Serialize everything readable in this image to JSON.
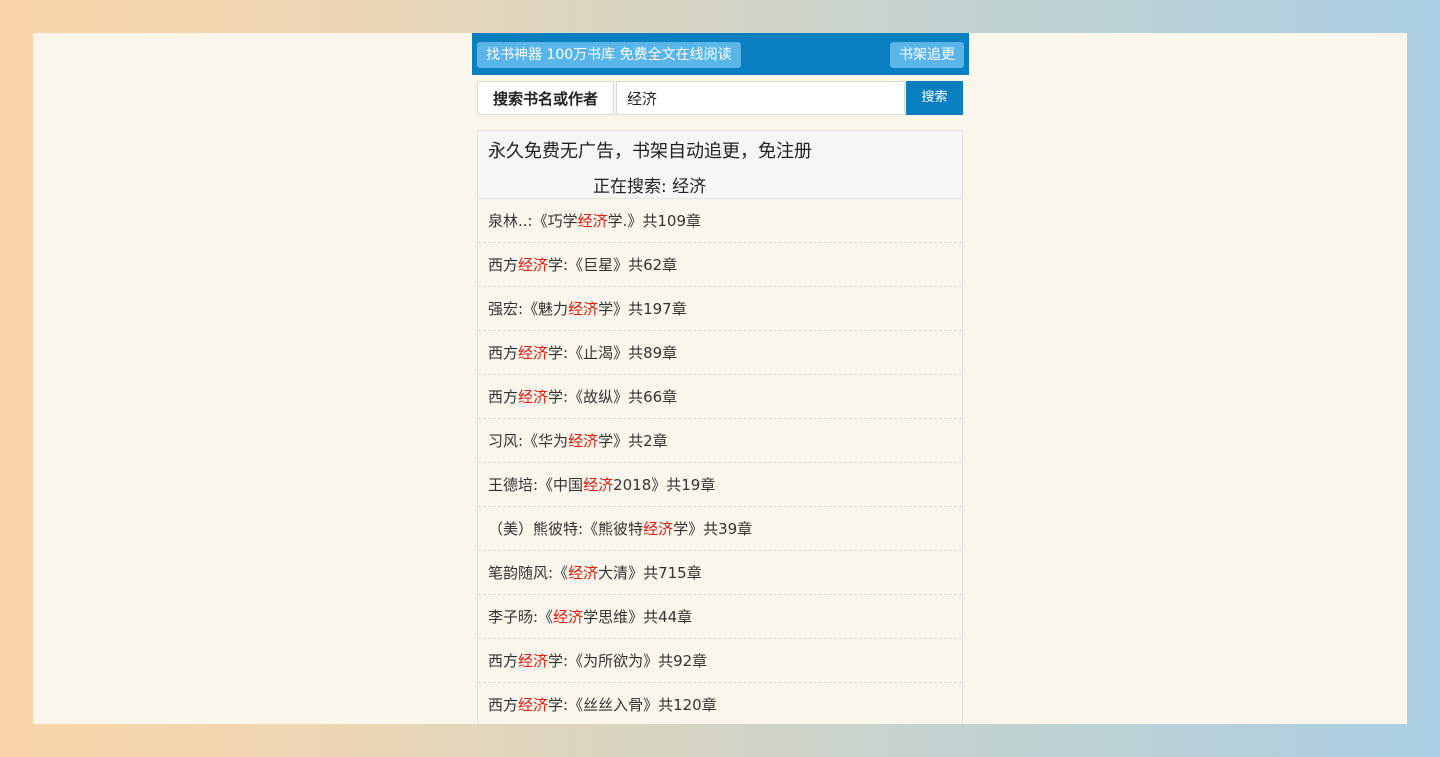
{
  "header": {
    "left_button": "找书神器 100万书库 免费全文在线阅读",
    "right_button": "书架追更"
  },
  "search": {
    "label": "搜索书名或作者",
    "value": "经济",
    "button": "搜索"
  },
  "panel": {
    "notice": "永久免费无广告，书架自动追更，免注册",
    "searching_prefix": "正在搜索: ",
    "searching_term": "经济"
  },
  "highlight_color": "#e8180c",
  "results": [
    {
      "pre": "泉林..:《巧学",
      "hl": "经济",
      "post": "学.》共109章"
    },
    {
      "pre": "西方",
      "hl": "经济",
      "post": "学:《巨星》共62章"
    },
    {
      "pre": "强宏:《魅力",
      "hl": "经济",
      "post": "学》共197章"
    },
    {
      "pre": "西方",
      "hl": "经济",
      "post": "学:《止渴》共89章"
    },
    {
      "pre": "西方",
      "hl": "经济",
      "post": "学:《故纵》共66章"
    },
    {
      "pre": "习风:《华为",
      "hl": "经济",
      "post": "学》共2章"
    },
    {
      "pre": "王德培:《中国",
      "hl": "经济",
      "post": "2018》共19章"
    },
    {
      "pre": "（美）熊彼特:《熊彼特",
      "hl": "经济",
      "post": "学》共39章"
    },
    {
      "pre": "笔韵随风:《",
      "hl": "经济",
      "post": "大清》共715章"
    },
    {
      "pre": "李子旸:《",
      "hl": "经济",
      "post": "学思维》共44章"
    },
    {
      "pre": "西方",
      "hl": "经济",
      "post": "学:《为所欲为》共92章"
    },
    {
      "pre": "西方",
      "hl": "经济",
      "post": "学:《丝丝入骨》共120章"
    }
  ]
}
